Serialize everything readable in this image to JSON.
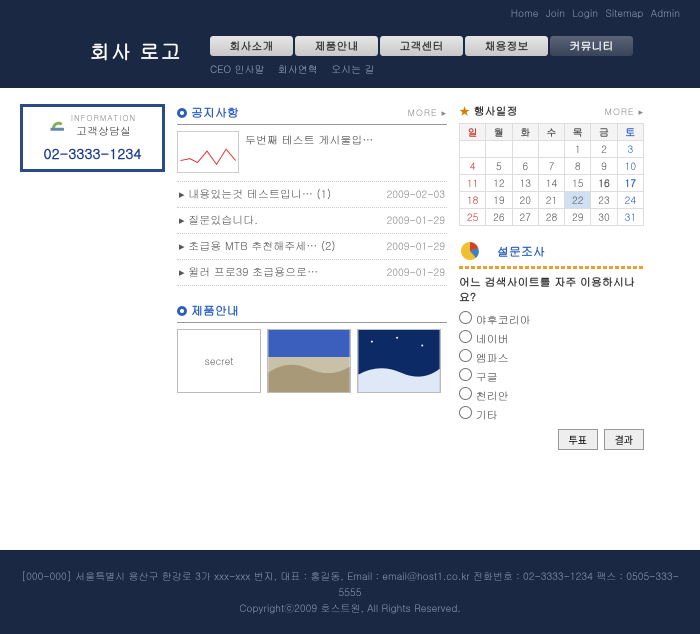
{
  "header": {
    "top_links": [
      "Home",
      "Join",
      "Login",
      "Sitemap",
      "Admin"
    ],
    "logo": "회사 로고",
    "nav": [
      "회사소개",
      "제품안내",
      "고객센터",
      "채용정보",
      "커뮤니티"
    ],
    "sub_nav": [
      "CEO 인사말",
      "회사연혁",
      "오시는 길"
    ]
  },
  "info_box": {
    "small": "INFORMATION",
    "title": "고객상담실",
    "phone": "02-3333-1234"
  },
  "notice": {
    "title": "공지사항",
    "more": "MORE ▸",
    "featured": "두번째 테스트 게시물입…",
    "items": [
      {
        "title": "내용있는것 테스트입니… (1)",
        "date": "2009-02-03"
      },
      {
        "title": "질문있습니다.",
        "date": "2009-01-29"
      },
      {
        "title": "초급용 MTB 추천해주세… (2)",
        "date": "2009-01-29"
      },
      {
        "title": "윌러 프로39 초급용으로…",
        "date": "2009-01-29"
      }
    ]
  },
  "products": {
    "title": "제품안내",
    "items": [
      "secret",
      "",
      "",
      ""
    ]
  },
  "calendar": {
    "title": "행사일정",
    "more": "MORE ▸",
    "dow": [
      "일",
      "월",
      "화",
      "수",
      "목",
      "금",
      "토"
    ],
    "weeks": [
      [
        "",
        "",
        "",
        "",
        "1",
        "2",
        "3"
      ],
      [
        "4",
        "5",
        "6",
        "7",
        "8",
        "9",
        "10"
      ],
      [
        "11",
        "12",
        "13",
        "14",
        "15",
        "16",
        "17"
      ],
      [
        "18",
        "19",
        "20",
        "21",
        "22",
        "23",
        "24"
      ],
      [
        "25",
        "26",
        "27",
        "28",
        "29",
        "30",
        "31"
      ]
    ],
    "bold_days": [
      "16",
      "17"
    ],
    "today": "22"
  },
  "survey": {
    "title": "설문조사",
    "question": "어느 검색사이트를 자주 이용하시나요?",
    "options": [
      "야후코리아",
      "네이버",
      "엠파스",
      "구글",
      "천리안",
      "기타"
    ],
    "btn_vote": "투표",
    "btn_result": "결과"
  },
  "footer": {
    "line1": "[000-000] 서울특별시 용산구 한강로 3가 xxx-xxx 번지,  대표 : 홍길동, Email : email@host1.co.kr 전화번호 : 02-3333-1234  팩스 : 0505-333-5555",
    "line2": "Copyrightⓒ2009 호스트원, All Rights Reserved."
  }
}
